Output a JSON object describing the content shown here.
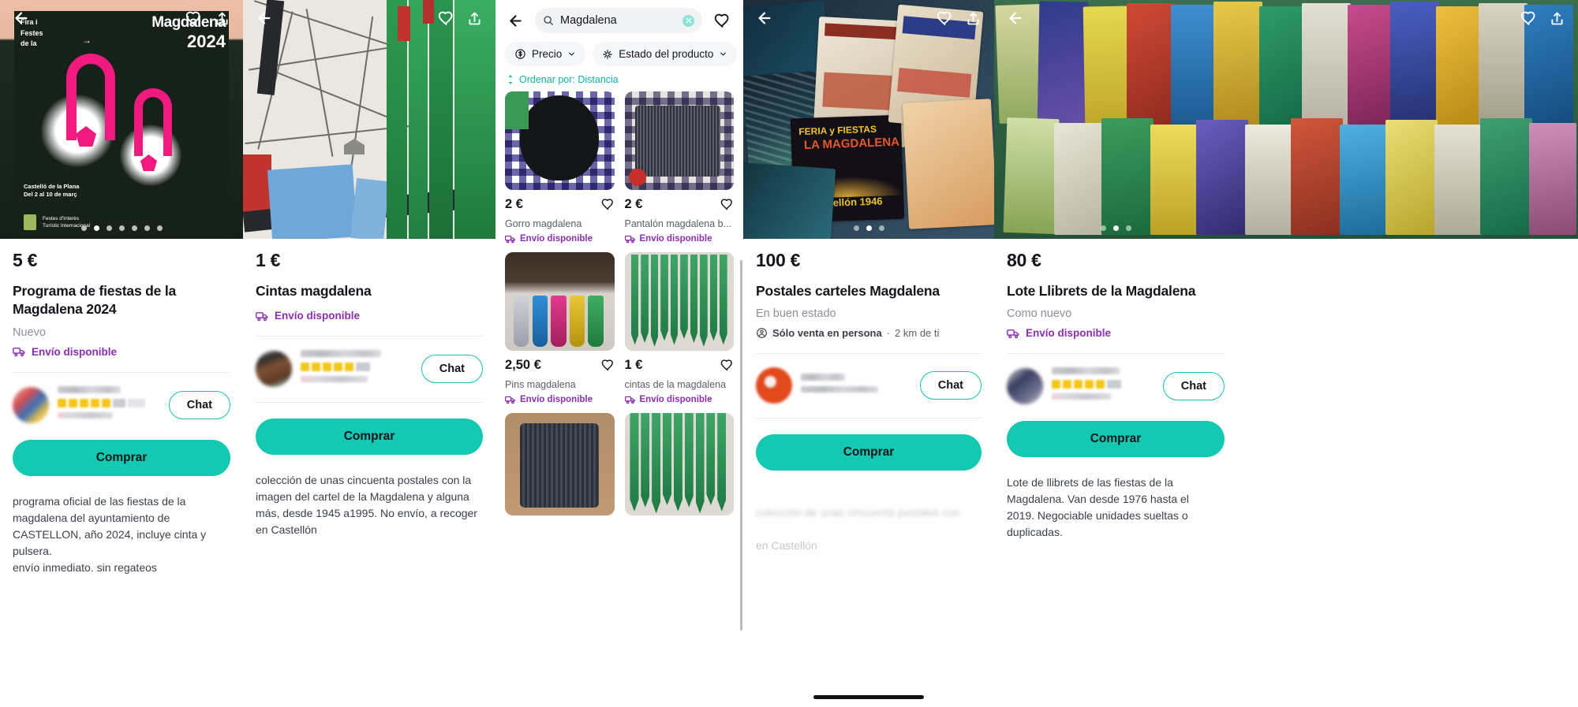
{
  "app": {
    "accent_teal": "#13c9b2",
    "accent_purple": "#8b2fb0",
    "text_dark": "#13151a",
    "text_muted": "#8b8f98"
  },
  "panels": [
    {
      "id": "detail-programa",
      "kind": "product-detail",
      "price": "5 €",
      "title": "Programa de fiestas de la Magdalena 2024",
      "condition": "Nuevo",
      "shipping_label": "Envío disponible",
      "chat_label": "Chat",
      "buy_label": "Comprar",
      "description": "programa oficial de las fiestas de la magdalena del ayuntamiento de CASTELLON, año 2024, incluye cinta y pulsera.\nenvío inmediato. sin regateos",
      "carousel": {
        "count": 7,
        "active_index": 1
      },
      "poster": {
        "badge_line1": "Fira i",
        "badge_line2": "Festes",
        "badge_line3": "de la",
        "big_title": "Magdalena",
        "big_year": "2024",
        "foot_line1": "Castelló de la Plana",
        "foot_line2": "Del 2 al 10 de març",
        "foot_line3": "Festes d'Interès",
        "foot_line4": "Turístic Internacional"
      }
    },
    {
      "id": "detail-cintas",
      "kind": "product-detail",
      "price": "1 €",
      "title": "Cintas magdalena",
      "condition": "",
      "shipping_label": "Envío disponible",
      "chat_label": "Chat",
      "buy_label": "Comprar",
      "description": "colección de unas cincuenta postales con la imagen del cartel de la Magdalena y alguna más, desde 1945 a1995.   No envío, a recoger en Castellón"
    },
    {
      "id": "search-results",
      "kind": "search",
      "search_value": "Magdalena",
      "search_icon": "search-icon",
      "clear_icon": "clear-icon",
      "back_icon": "back-arrow-icon",
      "favorite_icon": "heart-icon",
      "filters": [
        {
          "label": "Precio",
          "icon": "price-dollar-icon"
        },
        {
          "label": "Estado del producto",
          "icon": "condition-sparkle-icon"
        }
      ],
      "sort_label": "Ordenar por: Distancia",
      "results": [
        {
          "price": "2 €",
          "title": "Gorro magdalena",
          "shipping": "Envío disponible",
          "img": "gorro"
        },
        {
          "price": "2 €",
          "title": "Pantalón magdalena b...",
          "shipping": "Envío disponible",
          "img": "pantalon"
        },
        {
          "price": "2,50 €",
          "title": "Pins magdalena",
          "shipping": "Envío disponible",
          "img": "pins"
        },
        {
          "price": "1 €",
          "title": "cintas de la magdalena",
          "shipping": "Envío disponible",
          "img": "ribbons"
        },
        {
          "price": "",
          "title": "",
          "shipping": "",
          "img": "pants2"
        },
        {
          "price": "",
          "title": "",
          "shipping": "",
          "img": "ribbons2"
        }
      ]
    },
    {
      "id": "detail-postales",
      "kind": "product-detail",
      "price": "100 €",
      "title": "Postales carteles Magdalena",
      "condition": "En buen estado",
      "meetup_label": "Sólo venta en persona",
      "meetup_distance": "2 km de ti",
      "chat_label": "Chat",
      "buy_label": "Comprar",
      "description": "",
      "carousel": {
        "count": 3,
        "active_index": 1
      }
    },
    {
      "id": "detail-llibrets",
      "kind": "product-detail",
      "price": "80 €",
      "title": "Lote Llibrets de la Magdalena",
      "condition": "Como nuevo",
      "shipping_label": "Envío disponible",
      "chat_label": "Chat",
      "buy_label": "Comprar",
      "description": "Lote de llibrets de las fiestas de la Magdalena. Van desde 1976 hasta el 2019. Negociable unidades sueltas o duplicadas.",
      "carousel": {
        "count": 3,
        "active_index": 1
      }
    }
  ]
}
